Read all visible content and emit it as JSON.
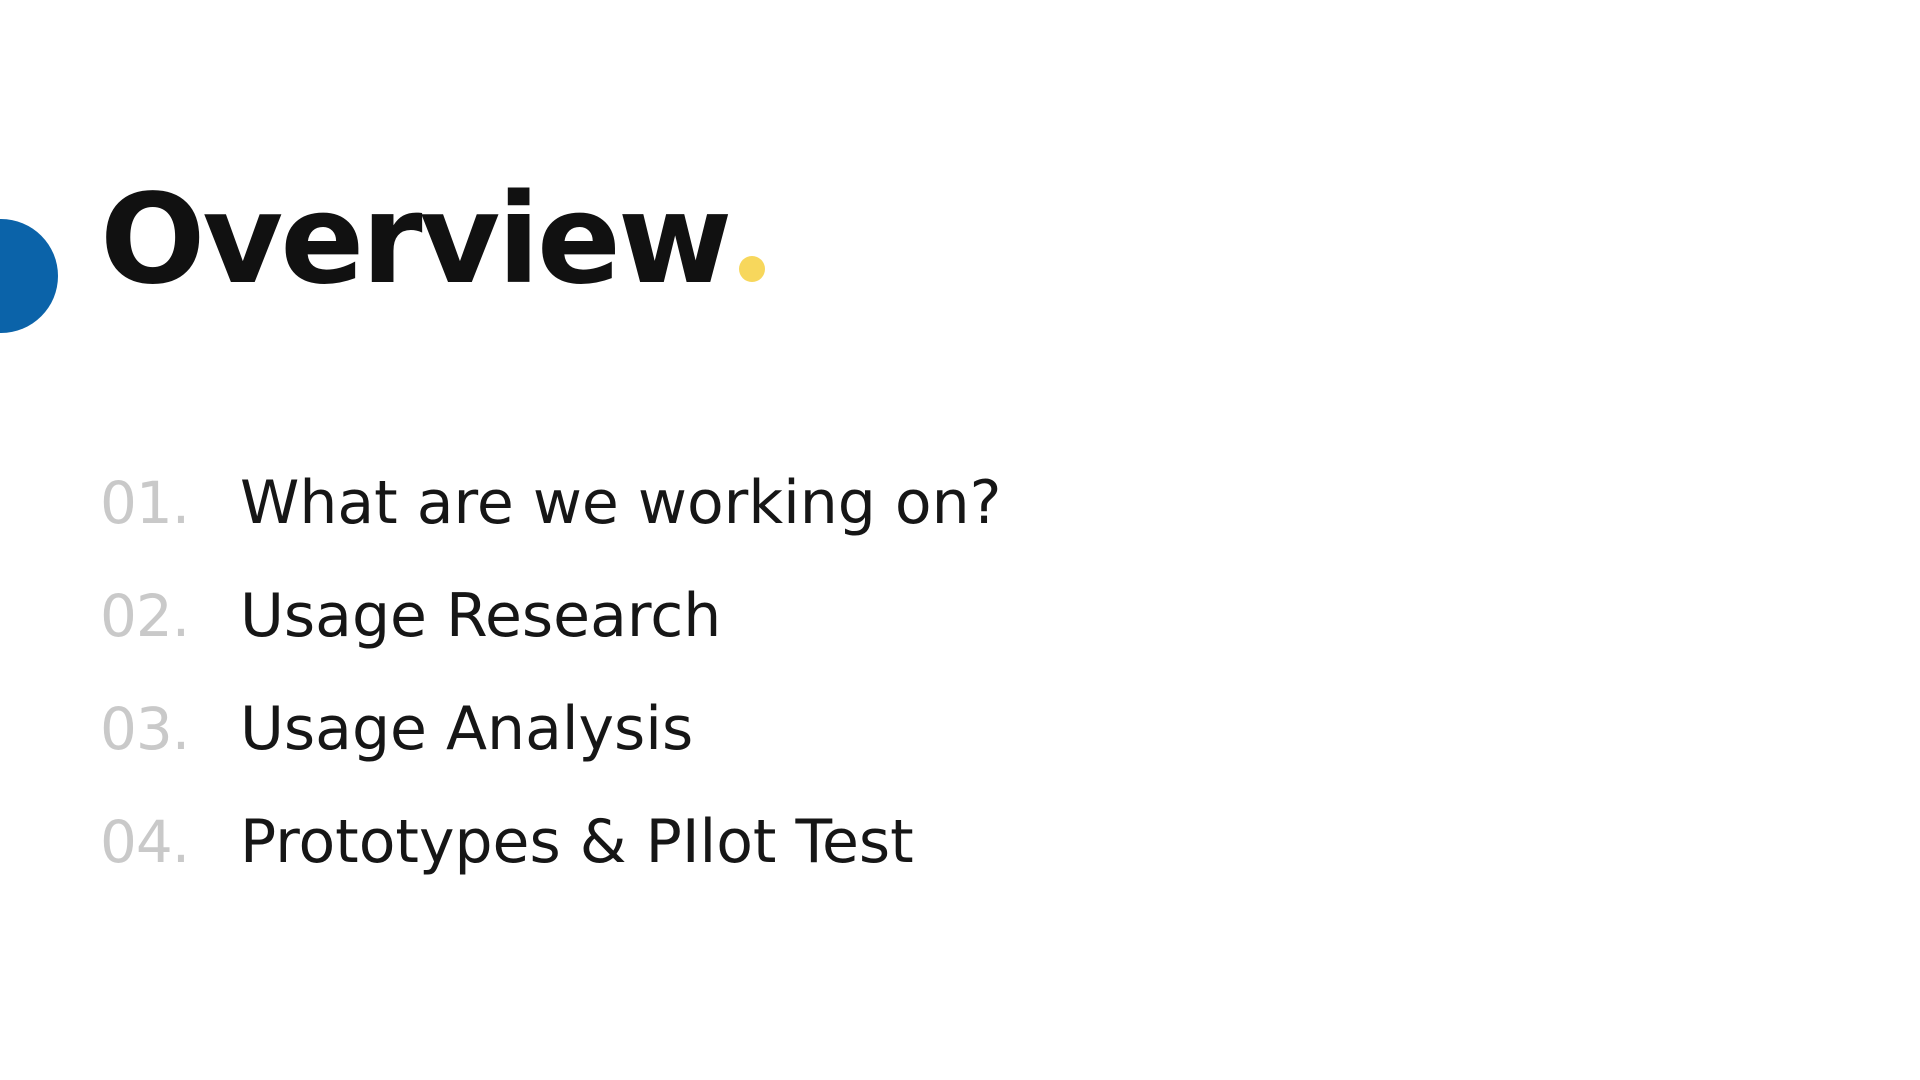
{
  "colors": {
    "accent_blue": "#0b63a9",
    "accent_yellow": "#f7d75c",
    "title_text": "#111111",
    "number_text": "#c9c9c9",
    "item_text": "#161616",
    "background": "#ffffff"
  },
  "slide": {
    "title": "Overview"
  },
  "agenda": {
    "items": [
      {
        "number": "01.",
        "label": "What are we working on?"
      },
      {
        "number": "02.",
        "label": "Usage Research"
      },
      {
        "number": "03.",
        "label": "Usage Analysis"
      },
      {
        "number": "04.",
        "label": "Prototypes & PIlot Test"
      }
    ]
  }
}
